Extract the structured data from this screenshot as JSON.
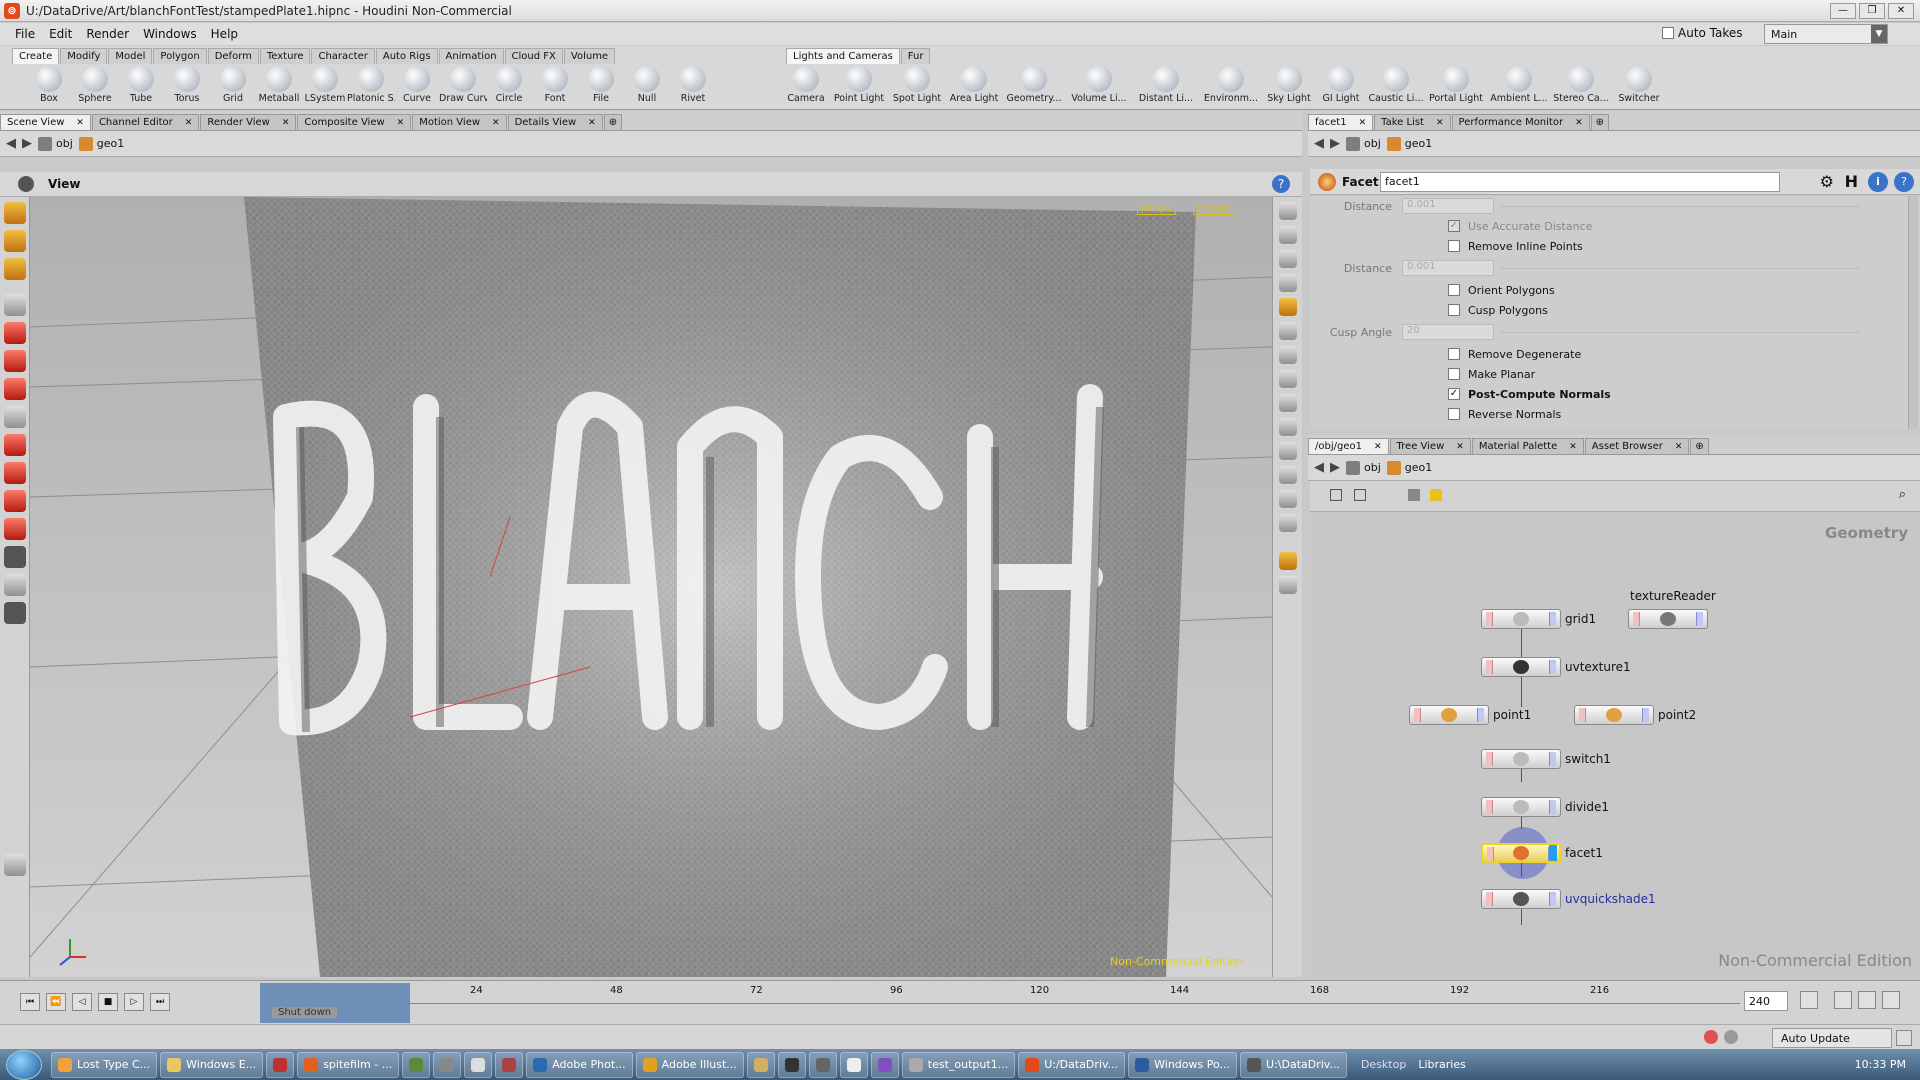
{
  "window": {
    "title": "U:/DataDrive/Art/blanchFontTest/stampedPlate1.hipnc - Houdini Non-Commercial"
  },
  "menu": [
    "File",
    "Edit",
    "Render",
    "Windows",
    "Help"
  ],
  "top_right": {
    "auto_takes": "Auto Takes",
    "desktop": "Main"
  },
  "shelf_left": {
    "tabs": [
      "Create",
      "Modify",
      "Model",
      "Polygon",
      "Deform",
      "Texture",
      "Character",
      "Auto Rigs",
      "Animation",
      "Cloud FX",
      "Volume"
    ],
    "tools": [
      "Box",
      "Sphere",
      "Tube",
      "Torus",
      "Grid",
      "Metaball",
      "LSystem",
      "Platonic S...",
      "Curve",
      "Draw Curve",
      "Circle",
      "Font",
      "File",
      "Null",
      "Rivet"
    ]
  },
  "shelf_right": {
    "tabs": [
      "Lights and Cameras",
      "Fur"
    ],
    "tools": [
      "Camera",
      "Point Light",
      "Spot Light",
      "Area Light",
      "Geometry...",
      "Volume Li...",
      "Distant Li...",
      "Environm...",
      "Sky Light",
      "GI Light",
      "Caustic Li...",
      "Portal Light",
      "Ambient L...",
      "Stereo Ca...",
      "Switcher"
    ]
  },
  "left_pane": {
    "tabs": [
      "Scene View",
      "Channel Editor",
      "Render View",
      "Composite View",
      "Motion View",
      "Details View"
    ],
    "path": [
      "obj",
      "geo1"
    ],
    "view_label": "View",
    "cam_persp": "persp1",
    "cam_nocam": "no cam",
    "watermark": "Non-Commercial Edition"
  },
  "param_pane": {
    "tabs": [
      "facet1",
      "Take List",
      "Performance Monitor"
    ],
    "path": [
      "obj",
      "geo1"
    ],
    "node_type": "Facet",
    "node_name": "facet1",
    "rows": [
      {
        "label": "Distance",
        "value": "0.001"
      },
      {
        "check": "Use Accurate Distance",
        "checked": true,
        "disabled": true
      },
      {
        "check": "Remove Inline Points",
        "checked": false
      },
      {
        "label": "Distance",
        "value": "0.001"
      },
      {
        "check": "Orient Polygons",
        "checked": false
      },
      {
        "check": "Cusp Polygons",
        "checked": false
      },
      {
        "label": "Cusp Angle",
        "value": "20"
      },
      {
        "check": "Remove Degenerate",
        "checked": false
      },
      {
        "check": "Make Planar",
        "checked": false
      },
      {
        "check": "Post-Compute Normals",
        "checked": true,
        "bold": true
      },
      {
        "check": "Reverse Normals",
        "checked": false
      }
    ]
  },
  "network_pane": {
    "tabs": [
      "/obj/geo1",
      "Tree View",
      "Material Palette",
      "Asset Browser"
    ],
    "path": [
      "obj",
      "geo1"
    ],
    "context_label": "Geometry",
    "watermark": "Non-Commercial Edition",
    "nodes": [
      {
        "name": "grid1"
      },
      {
        "name": "textureReader"
      },
      {
        "name": "uvtexture1"
      },
      {
        "name": "point1"
      },
      {
        "name": "point2"
      },
      {
        "name": "switch1"
      },
      {
        "name": "divide1"
      },
      {
        "name": "facet1"
      },
      {
        "name": "uvquickshade1"
      }
    ]
  },
  "timeline": {
    "ticks": [
      "24",
      "48",
      "72",
      "96",
      "120",
      "144",
      "168",
      "192",
      "216"
    ],
    "end_frame": "240",
    "shutdown": "Shut down",
    "auto_update": "Auto Update"
  },
  "taskbar": {
    "items": [
      "Lost Type C...",
      "Windows E...",
      "spitefilm - ...",
      "Adobe Phot...",
      "Adobe Illust...",
      "test_output1...",
      "U:/DataDriv...",
      "Windows Po...",
      "U:\\DataDriv..."
    ],
    "desktop": "Desktop",
    "libraries": "Libraries",
    "clock": "10:33 PM"
  },
  "colors": {
    "accent": "#e2a020",
    "selected_node": "#f0d020",
    "node_blue": "#2a2aa0"
  }
}
